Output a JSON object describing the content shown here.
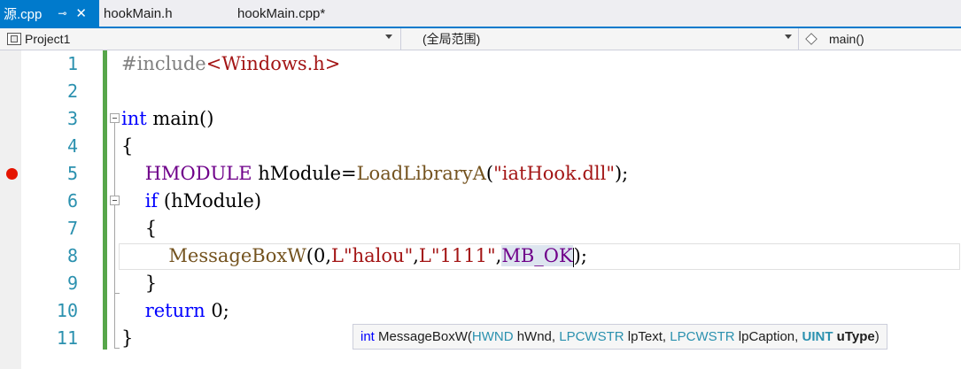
{
  "tabs": [
    {
      "label": "源.cpp",
      "active": true,
      "pin_glyph": "⊸",
      "close_glyph": "✕"
    },
    {
      "label": "hookMain.h",
      "active": false
    },
    {
      "label": "hookMain.cpp*",
      "active": false
    }
  ],
  "navbar": {
    "project": "Project1",
    "scope": "(全局范围)",
    "member": "main()"
  },
  "editor": {
    "line_numbers": [
      "1",
      "2",
      "3",
      "4",
      "5",
      "6",
      "7",
      "8",
      "9",
      "10",
      "11"
    ],
    "breakpoint_line": 5,
    "lines": [
      {
        "tokens": [
          {
            "t": "#include",
            "c": "pp"
          },
          {
            "t": "<Windows.h>",
            "c": "inc"
          }
        ]
      },
      {
        "tokens": []
      },
      {
        "tokens": [
          {
            "t": "int",
            "c": "kw"
          },
          {
            "t": " main()",
            "c": "plain"
          }
        ]
      },
      {
        "tokens": [
          {
            "t": "{",
            "c": "plain"
          }
        ]
      },
      {
        "tokens": [
          {
            "t": "    ",
            "c": "plain"
          },
          {
            "t": "HMODULE",
            "c": "macro"
          },
          {
            "t": " hModule=",
            "c": "plain"
          },
          {
            "t": "LoadLibraryA",
            "c": "fn"
          },
          {
            "t": "(",
            "c": "plain"
          },
          {
            "t": "\"iatHook.dll\"",
            "c": "str"
          },
          {
            "t": ");",
            "c": "plain"
          }
        ]
      },
      {
        "tokens": [
          {
            "t": "    ",
            "c": "plain"
          },
          {
            "t": "if",
            "c": "kw"
          },
          {
            "t": " (hModule)",
            "c": "plain"
          }
        ]
      },
      {
        "tokens": [
          {
            "t": "    {",
            "c": "plain"
          }
        ]
      },
      {
        "tokens": [
          {
            "t": "        ",
            "c": "plain"
          },
          {
            "t": "MessageBoxW",
            "c": "fn"
          },
          {
            "t": "(0,",
            "c": "plain"
          },
          {
            "t": "L\"halou\"",
            "c": "str"
          },
          {
            "t": ",",
            "c": "plain"
          },
          {
            "t": "L\"1111\"",
            "c": "str"
          },
          {
            "t": ",",
            "c": "plain"
          },
          {
            "t": "MB_OK",
            "c": "macro mb-hl"
          },
          {
            "t": "|",
            "c": "caret"
          },
          {
            "t": ");",
            "c": "plain"
          }
        ]
      },
      {
        "tokens": [
          {
            "t": "    }",
            "c": "plain"
          }
        ]
      },
      {
        "tokens": [
          {
            "t": "    ",
            "c": "plain"
          },
          {
            "t": "return",
            "c": "kw"
          },
          {
            "t": " 0;",
            "c": "plain"
          }
        ]
      },
      {
        "tokens": [
          {
            "t": "}",
            "c": "plain"
          }
        ]
      }
    ]
  },
  "tooltip": {
    "segments": [
      {
        "t": "int",
        "c": "t-kw"
      },
      {
        "t": " MessageBoxW(",
        "c": "t-param"
      },
      {
        "t": "HWND",
        "c": "t-type"
      },
      {
        "t": " hWnd, ",
        "c": "t-param"
      },
      {
        "t": "LPCWSTR",
        "c": "t-type"
      },
      {
        "t": " lpText, ",
        "c": "t-param"
      },
      {
        "t": "LPCWSTR",
        "c": "t-type"
      },
      {
        "t": " lpCaption, ",
        "c": "t-param"
      },
      {
        "t": "UINT",
        "c": "t-type t-bold"
      },
      {
        "t": " uType",
        "c": "t-param t-bold"
      },
      {
        "t": ")",
        "c": "t-param"
      }
    ]
  },
  "colors": {
    "accent": "#007acc",
    "breakpoint": "#e51400",
    "change_bar": "#57a64a",
    "line_number": "#2b91af"
  }
}
